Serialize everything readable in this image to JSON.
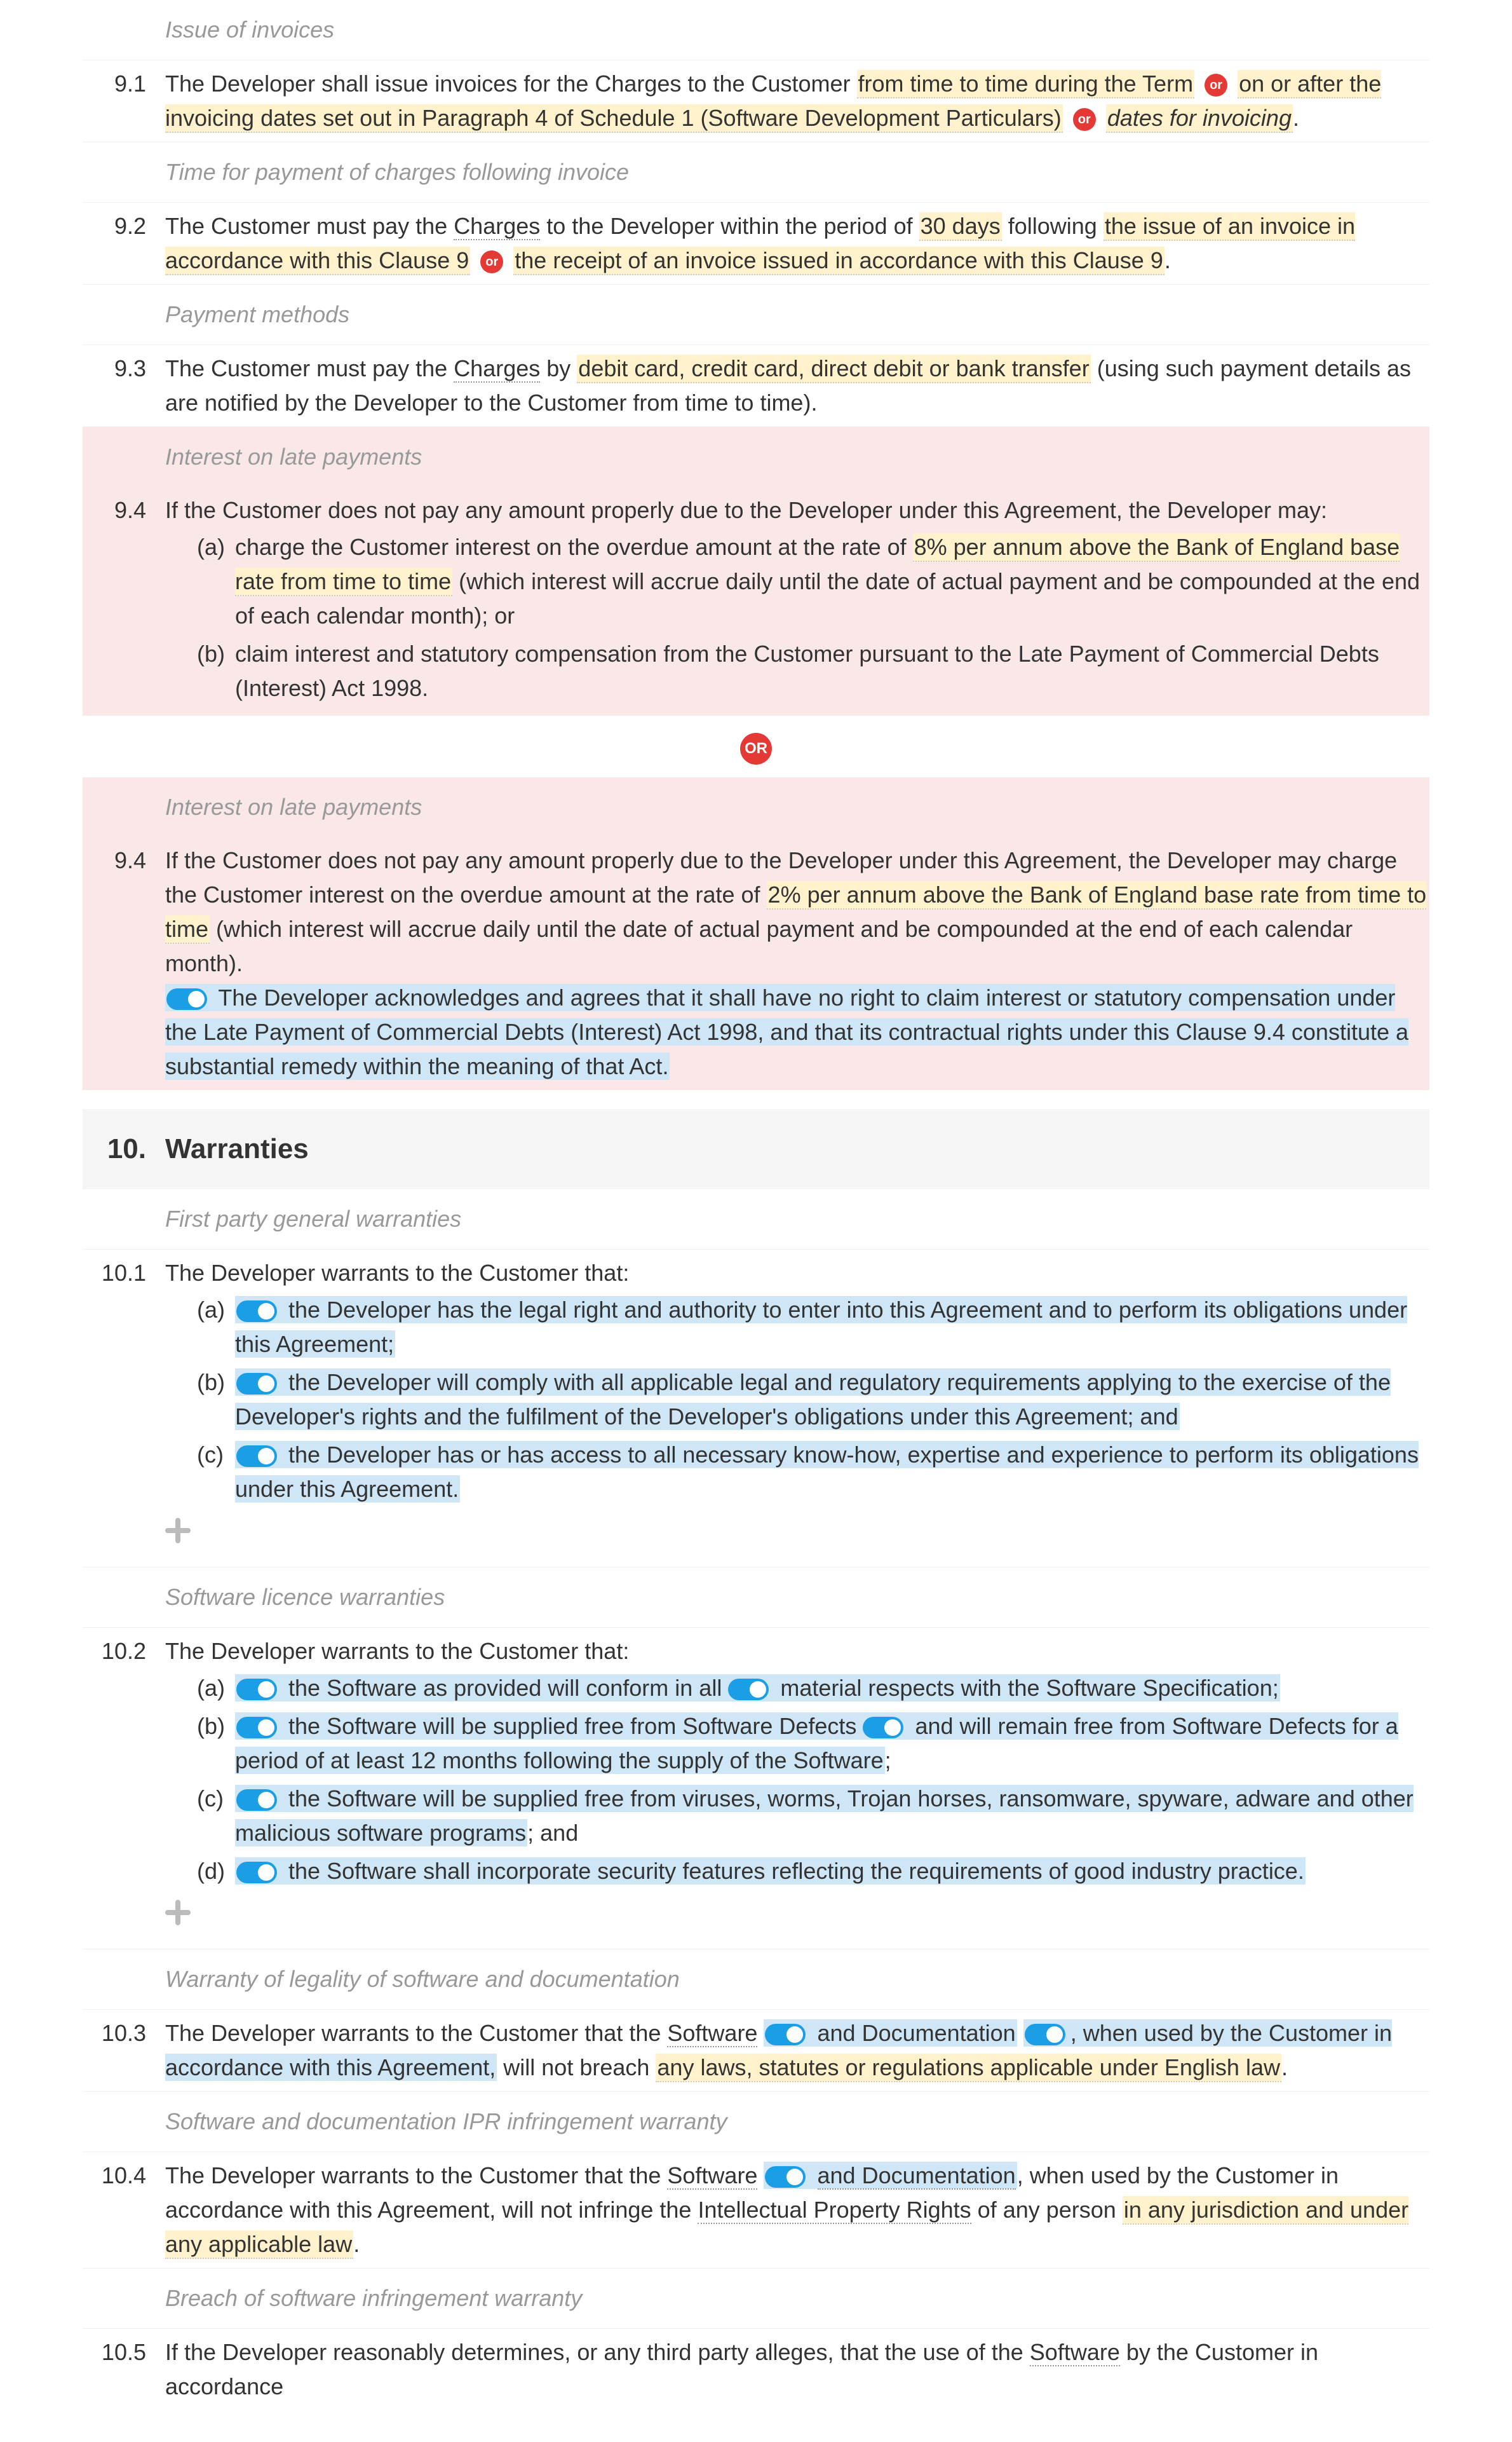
{
  "sec9": {
    "sub_issue": "Issue of invoices",
    "c91_num": "9.1",
    "c91_a": "The Developer shall issue invoices for the Charges to the Customer ",
    "c91_b": "from time to time during the Term",
    "c91_c": " on or after the invoicing dates set out in Paragraph 4 of Schedule 1 (Software Development Particulars)",
    "c91_d": "dates for invoicing",
    "c91_e": ".",
    "sub_time": "Time for payment of charges following invoice",
    "c92_num": "9.2",
    "c92_a": "The Customer must pay the ",
    "c92_b": "Charges",
    "c92_c": " to the Developer within the period of ",
    "c92_d": "30 days",
    "c92_e": " following ",
    "c92_f": "the issue of an invoice in accordance with this Clause 9",
    "c92_g": "the receipt of an invoice issued in accordance with this Clause 9",
    "c92_h": ".",
    "sub_pm": "Payment methods",
    "c93_num": "9.3",
    "c93_a": "The Customer must pay the ",
    "c93_b": "Charges",
    "c93_c": " by ",
    "c93_d": "debit card, credit card, direct debit or bank transfer",
    "c93_e": " (using such payment details as are notified by the Developer to the Customer from time to time).",
    "sub_interest": "Interest on late payments",
    "c94_num": "9.4",
    "c94_intro": "If the Customer does not pay any amount properly due to the Developer under this Agreement, the Developer may:",
    "c94_a_letter": "(a)",
    "c94_a1": "charge the Customer interest on the overdue amount at the rate of ",
    "c94_a2": "8% per annum above the Bank of England base rate from time to time",
    "c94_a3": " (which interest will accrue daily until the date of actual payment and be compounded at the end of each calendar month); or",
    "c94_b_letter": "(b)",
    "c94_b": "claim interest and statutory compensation from the Customer pursuant to the Late Payment of Commercial Debts (Interest) Act 1998.",
    "or_label": "OR",
    "or_small": "or",
    "c94v2_num": "9.4",
    "c94v2_a": "If the Customer does not pay any amount properly due to the Developer under this Agreement, the Developer may charge the Customer interest on the overdue amount at the rate of ",
    "c94v2_b": "2% per annum above the Bank of England base rate from time to time",
    "c94v2_c": " (which interest will accrue daily until the date of actual payment and be compounded at the end of each calendar month).",
    "c94v2_d": "The Developer acknowledges and agrees that it shall have no right to claim interest or statutory compensation under the Late Payment of Commercial Debts (Interest) Act 1998, and that its contractual rights under this Clause 9.4 constitute a substantial remedy within the meaning of that Act."
  },
  "sec10": {
    "num": "10.",
    "title": "Warranties",
    "sub_fp": "First party general warranties",
    "c101_num": "10.1",
    "c101_intro": "The Developer warrants to the Customer that:",
    "c101_a_letter": "(a)",
    "c101_a": "the Developer has the legal right and authority to enter into this Agreement and to perform its obligations under this Agreement;",
    "c101_b_letter": "(b)",
    "c101_b": "the Developer will comply with all applicable legal and regulatory requirements applying to the exercise of the Developer's rights and the fulfilment of the Developer's obligations under this Agreement; and",
    "c101_c_letter": "(c)",
    "c101_c": "the Developer has or has access to all necessary know-how, expertise and experience to perform its obligations under this Agreement.",
    "sub_slw": "Software licence warranties",
    "c102_num": "10.2",
    "c102_intro": "The Developer warrants to the Customer that:",
    "c102_a_letter": "(a)",
    "c102_a1": "the Software as provided will conform in all ",
    "c102_a2": "material",
    "c102_a3": " respects with the Software Specification;",
    "c102_b_letter": "(b)",
    "c102_b1": "the Software will be supplied free from Software Defects ",
    "c102_b2": " and will remain free from Software Defects for a period of at least 12 months following the supply of the Software",
    "c102_b3": ";",
    "c102_c_letter": "(c)",
    "c102_c1": "the Software will be supplied free from viruses, worms, Trojan horses, ransomware, spyware, adware and other malicious software programs",
    "c102_c2": "; and",
    "c102_d_letter": "(d)",
    "c102_d": "the Software shall incorporate security features reflecting the requirements of good industry practice.",
    "sub_leg": "Warranty of legality of software and documentation",
    "c103_num": "10.3",
    "c103_a": "The Developer warrants to the Customer that the ",
    "c103_b": "Software",
    "c103_c": "and Documentation",
    "c103_d": ", when used by the Customer in accordance with this Agreement,",
    "c103_e": " will not breach ",
    "c103_f": "any laws, statutes or regulations applicable under English law",
    "c103_g": ".",
    "sub_ipr": "Software and documentation IPR infringement warranty",
    "c104_num": "10.4",
    "c104_a": "The Developer warrants to the Customer that the ",
    "c104_b": "Software",
    "c104_c": "and Documentation",
    "c104_d": ", when used by the Customer in accordance with this Agreement, will not infringe the ",
    "c104_e": "Intellectual Property Rights",
    "c104_f": " of any person ",
    "c104_g": "in any jurisdiction and under any applicable law",
    "c104_h": ".",
    "sub_breach": "Breach of software infringement warranty",
    "c105_num": "10.5",
    "c105_a": "If the Developer reasonably determines, or any third party alleges, that the use of the ",
    "c105_b": "Software",
    "c105_c": " by the Customer in accordance"
  }
}
